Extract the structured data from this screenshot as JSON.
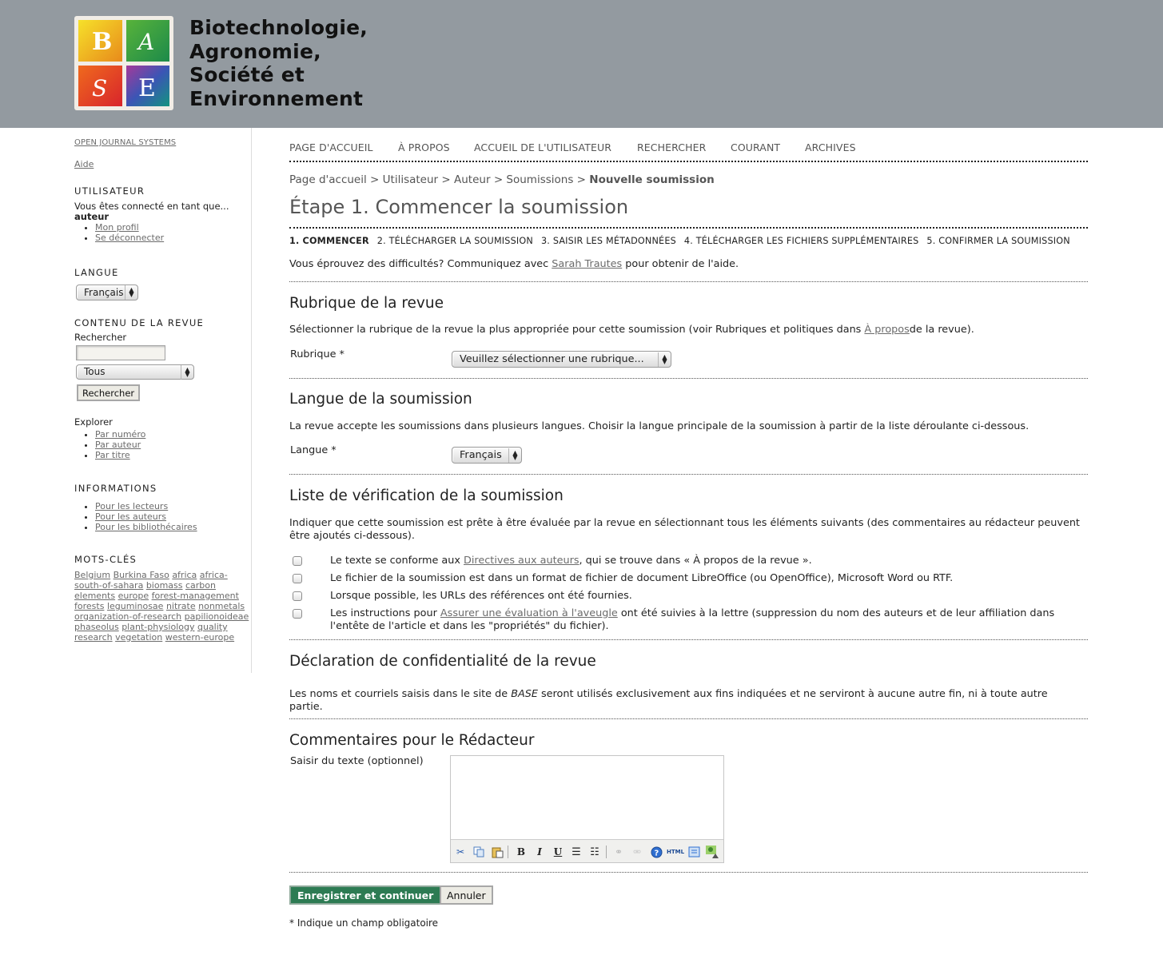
{
  "header": {
    "logo_letters": [
      "B",
      "A",
      "S",
      "E"
    ],
    "title_lines": [
      "Biotechnologie,",
      "Agronomie,",
      "Société et",
      "Environnement"
    ]
  },
  "sidebar": {
    "ojs_link": "OPEN JOURNAL SYSTEMS",
    "help_link": "Aide",
    "user": {
      "title": "UTILISATEUR",
      "logged_as": "Vous êtes connecté en tant que...",
      "username": "auteur",
      "links": [
        "Mon profil",
        "Se déconnecter"
      ]
    },
    "language": {
      "title": "LANGUE",
      "selected": "Français"
    },
    "journal_content": {
      "title": "CONTENU DE LA REVUE",
      "search_label": "Rechercher",
      "search_value": "",
      "scope_selected": "Tous",
      "search_button": "Rechercher",
      "browse_label": "Explorer",
      "browse_links": [
        "Par numéro",
        "Par auteur",
        "Par titre"
      ]
    },
    "information": {
      "title": "INFORMATIONS",
      "links": [
        "Pour les lecteurs",
        "Pour les auteurs",
        "Pour les bibliothécaires"
      ]
    },
    "keywords": {
      "title": "MOTS-CLÉS",
      "items": [
        "Belgium",
        "Burkina Faso",
        "africa",
        "africa-south-of-sahara",
        "biomass",
        "carbon",
        "elements",
        "europe",
        "forest-management",
        "forests",
        "leguminosae",
        "nitrate",
        "nonmetals",
        "organization-of-research",
        "papilionoideae",
        "phaseolus",
        "plant-physiology",
        "quality",
        "research",
        "vegetation",
        "western-europe"
      ]
    }
  },
  "nav": {
    "items": [
      "PAGE D'ACCUEIL",
      "À PROPOS",
      "ACCUEIL DE L'UTILISATEUR",
      "RECHERCHER",
      "COURANT",
      "ARCHIVES"
    ]
  },
  "breadcrumb": {
    "items": [
      "Page d'accueil",
      "Utilisateur",
      "Auteur",
      "Soumissions"
    ],
    "current": "Nouvelle soumission",
    "separator": ">"
  },
  "page_title": "Étape 1. Commencer la soumission",
  "steps": [
    "1. COMMENCER",
    "2. TÉLÉCHARGER LA SOUMISSION",
    "3. SAISIR LES MÉTADONNÉES",
    "4. TÉLÉCHARGER LES FICHIERS SUPPLÉMENTAIRES",
    "5. CONFIRMER LA SOUMISSION"
  ],
  "help": {
    "before": "Vous éprouvez des difficultés? Communiquez avec ",
    "contact": "Sarah Trautes",
    "after": " pour obtenir de l'aide."
  },
  "section_rubrique": {
    "heading": "Rubrique de la revue",
    "desc_before": "Sélectionner la rubrique de la revue la plus appropriée pour cette soumission (voir Rubriques et politiques dans ",
    "desc_link": "À propos",
    "desc_after": "de la revue).",
    "label": "Rubrique *",
    "selected": "Veuillez sélectionner une rubrique..."
  },
  "section_langue": {
    "heading": "Langue de la soumission",
    "desc": "La revue accepte les soumissions dans plusieurs langues. Choisir la langue principale de la soumission à partir de la liste déroulante ci-dessous.",
    "label": "Langue *",
    "selected": "Français"
  },
  "section_checklist": {
    "heading": "Liste de vérification de la soumission",
    "desc": "Indiquer que cette soumission est prête à être évaluée par la revue en sélectionnant tous les éléments suivants (des commentaires au rédacteur peuvent être ajoutés ci-dessous).",
    "items": [
      {
        "before": "Le texte se conforme aux ",
        "link": "Directives aux auteurs",
        "after": ", qui se trouve dans « À propos de la revue ».",
        "checked": false
      },
      {
        "before": "Le fichier de la soumission est dans un format de fichier de document LibreOffice (ou OpenOffice), Microsoft Word ou RTF.",
        "link": "",
        "after": "",
        "checked": false
      },
      {
        "before": "Lorsque possible, les URLs des références ont été fournies.",
        "link": "",
        "after": "",
        "checked": false
      },
      {
        "before": "Les instructions pour ",
        "link": "Assurer une évaluation à l'aveugle",
        "after": " ont été suivies à la lettre (suppression du nom des auteurs et de leur affiliation dans l'entête de l'article et dans les \"propriétés\" du fichier).",
        "checked": false
      }
    ]
  },
  "section_privacy": {
    "heading": "Déclaration de confidentialité de la revue",
    "text_before": "Les noms et courriels saisis dans le site de ",
    "text_em": "BASE",
    "text_after": " seront utilisés exclusivement aux fins indiquées et ne serviront à aucune autre fin, ni à toute autre partie."
  },
  "section_comments": {
    "heading": "Commentaires pour le Rédacteur",
    "label": "Saisir du texte (optionnel)",
    "value": "",
    "toolbar": [
      "cut-icon",
      "copy-icon",
      "paste-icon",
      "bold-icon",
      "italic-icon",
      "underline-icon",
      "bullet-list-icon",
      "numbered-list-icon",
      "link-icon",
      "unlink-icon",
      "help-icon",
      "html-icon",
      "fullscreen-icon",
      "image-upload-icon"
    ],
    "html_label": "HTML"
  },
  "actions": {
    "save": "Enregistrer et continuer",
    "cancel": "Annuler",
    "required_note": "* Indique un champ obligatoire"
  }
}
